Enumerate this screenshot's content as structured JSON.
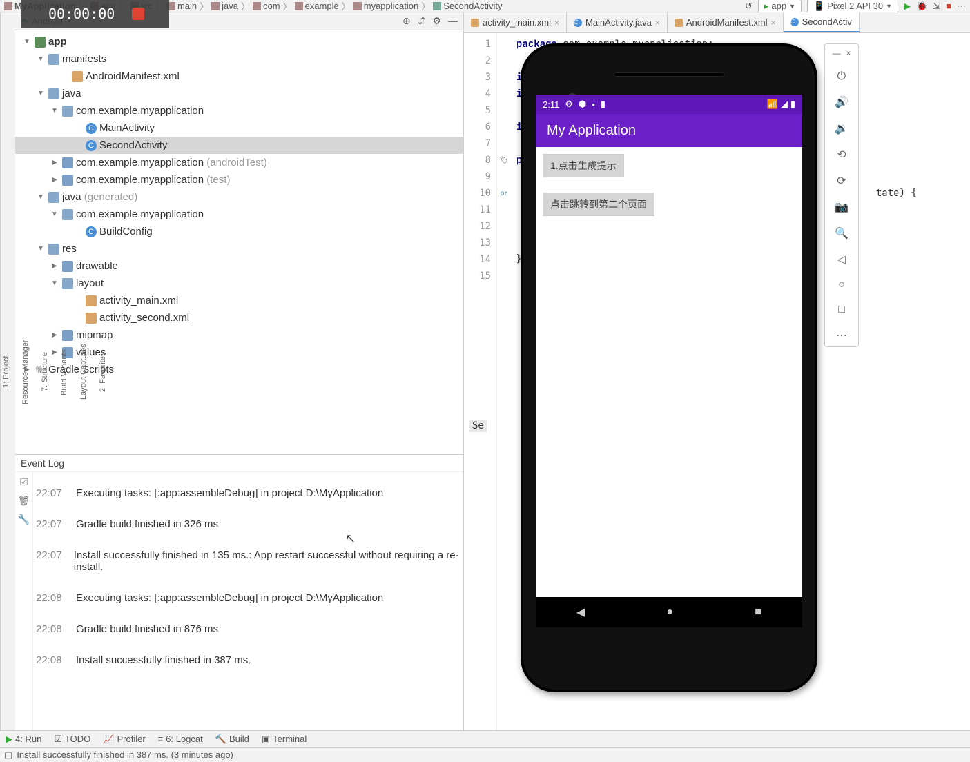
{
  "recording": {
    "time": "00:00:00"
  },
  "breadcrumb": {
    "items": [
      "MyApplication",
      "app",
      "src",
      "main",
      "java",
      "com",
      "example",
      "myapplication",
      "SecondActivity"
    ]
  },
  "runConfig": {
    "label": "app"
  },
  "device": {
    "label": "Pixel 2 API 30"
  },
  "projectView": {
    "title": "Android"
  },
  "tree": {
    "app": "app",
    "manifests": "manifests",
    "manifest_file": "AndroidManifest.xml",
    "java": "java",
    "pkg": "com.example.myapplication",
    "main_act": "MainActivity",
    "second_act": "SecondActivity",
    "pkg_androidtest": "(androidTest)",
    "pkg_test": "(test)",
    "java_gen": "java",
    "java_gen_suffix": "(generated)",
    "buildconfig": "BuildConfig",
    "res": "res",
    "drawable": "drawable",
    "layout": "layout",
    "layout_main": "activity_main.xml",
    "layout_second": "activity_second.xml",
    "mipmap": "mipmap",
    "values": "values",
    "gradle": "Gradle Scripts"
  },
  "eventLog": {
    "title": "Event Log",
    "entries": [
      {
        "time": "22:07",
        "msg": "Executing tasks: [:app:assembleDebug] in project D:\\MyApplication"
      },
      {
        "time": "22:07",
        "msg": "Gradle build finished in 326 ms"
      },
      {
        "time": "22:07",
        "msg": "Install successfully finished in 135 ms.: App restart successful without requiring a re-install."
      },
      {
        "time": "22:08",
        "msg": "Executing tasks: [:app:assembleDebug] in project D:\\MyApplication"
      },
      {
        "time": "22:08",
        "msg": "Gradle build finished in 876 ms"
      },
      {
        "time": "22:08",
        "msg": "Install successfully finished in 387 ms."
      }
    ]
  },
  "editorTabs": [
    {
      "label": "activity_main.xml",
      "type": "xml"
    },
    {
      "label": "MainActivity.java",
      "type": "class"
    },
    {
      "label": "AndroidManifest.xml",
      "type": "xml"
    },
    {
      "label": "SecondActiv",
      "type": "class",
      "active": true
    }
  ],
  "code": {
    "lines": [
      "package com.example.myapplication;",
      "",
      "imp",
      "imp",
      "",
      "imp",
      "",
      "pub",
      "",
      "                                                              tate) {",
      "",
      "",
      "",
      "}",
      ""
    ],
    "truncated": "Se"
  },
  "emulator": {
    "clock": "2:11",
    "app_title": "My Application",
    "btn1": "1.点击生成提示",
    "btn2": "点击跳转到第二个页面"
  },
  "bottomTabs": {
    "run": "4: Run",
    "todo": "TODO",
    "profiler": "Profiler",
    "logcat": "6: Logcat",
    "build": "Build",
    "terminal": "Terminal"
  },
  "statusBar": {
    "msg": "Install successfully finished in 387 ms. (3 minutes ago)"
  },
  "sideRails": {
    "left": [
      "1: Project",
      "Resource Manager",
      "7: Structure",
      "Build Variants",
      "Layout Captures",
      "2: Favorites"
    ]
  }
}
